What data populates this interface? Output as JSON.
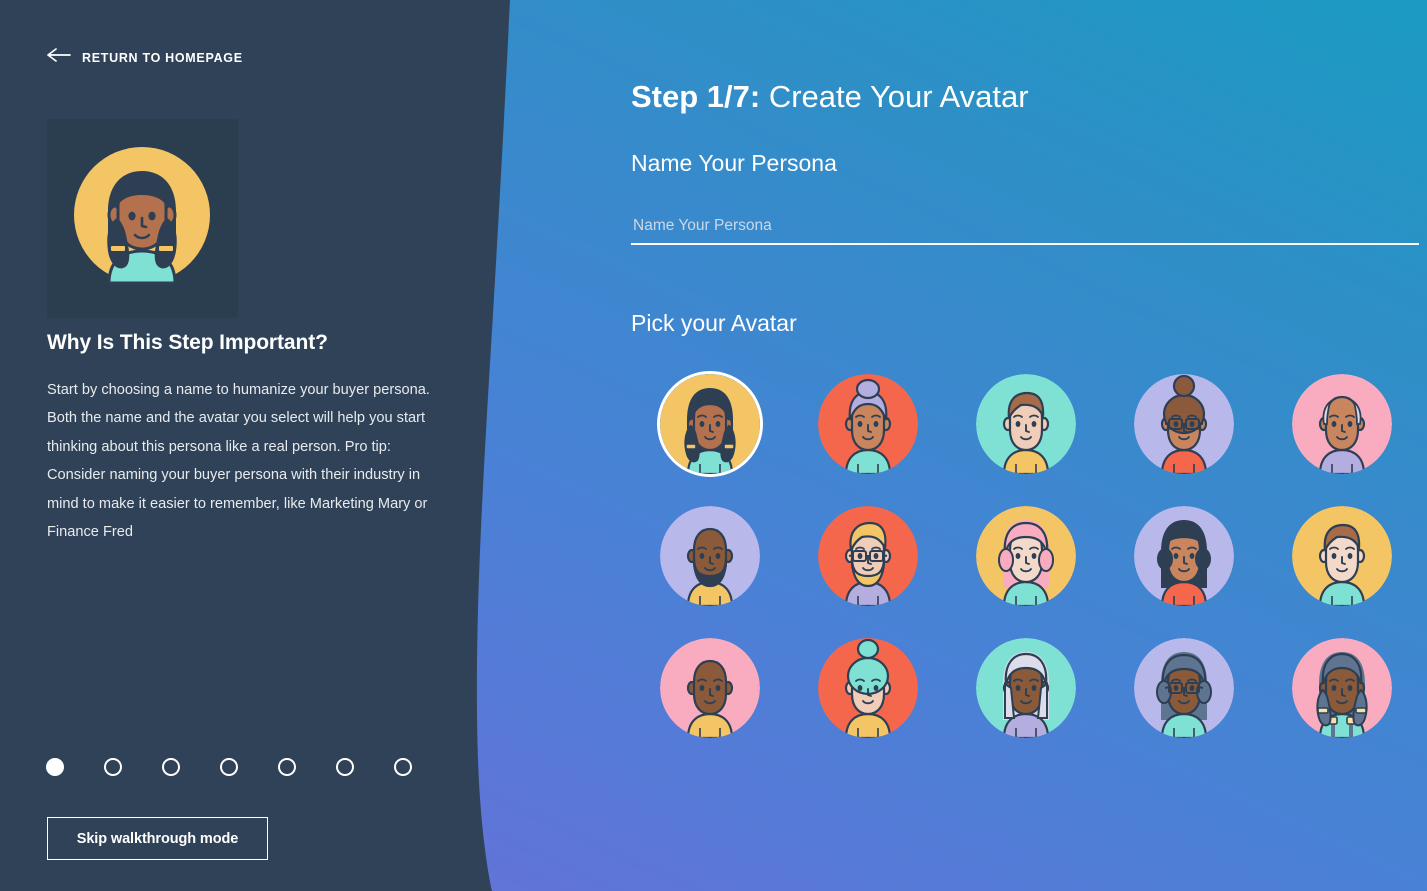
{
  "sidebar": {
    "return_link": {
      "label": "RETURN TO HOMEPAGE",
      "icon": "arrow-left-icon"
    },
    "preview": {
      "alt": "selected-avatar-preview",
      "bg_color": "#2b3e50",
      "circle_color": "#f4c565"
    },
    "heading": "Why Is This Step Important?",
    "body": "Start by choosing a name to humanize your buyer persona. Both the name and the avatar you select will help you start thinking about this persona like a real person. Pro tip: Consider naming your buyer persona with their industry in mind to make it easier to remember, like Marketing Mary or Finance Fred",
    "progress": {
      "total": 7,
      "current": 1
    },
    "skip_button_label": "Skip walkthrough mode",
    "bg_color": "#2f4257"
  },
  "main": {
    "step_prefix": "Step 1/7:",
    "step_title": "Create Your Avatar",
    "name_field": {
      "label": "Name Your Persona",
      "placeholder": "Name Your Persona",
      "value": ""
    },
    "pick_label": "Pick your Avatar",
    "selected_index": 0,
    "avatars": [
      {
        "name": "avatar-braids-tan-yellow",
        "bg": "#f4c565",
        "skin": "#b4714d",
        "hair": "#2e3f54",
        "shirt": "#7fe0d4",
        "accent": "#f4c565",
        "style": "braids",
        "glasses": false,
        "beard": false
      },
      {
        "name": "avatar-bun-lavender-orange",
        "bg": "#f4674d",
        "skin": "#c9865e",
        "hair": "#b4aee0",
        "shirt": "#7fe0d4",
        "accent": "#b4aee0",
        "style": "bun",
        "glasses": false,
        "beard": false
      },
      {
        "name": "avatar-swoop-brown-mint",
        "bg": "#7fe0d4",
        "skin": "#f0cdb8",
        "hair": "#a86b4a",
        "shirt": "#f4c565",
        "accent": "#a86b4a",
        "style": "swoop",
        "glasses": false,
        "beard": false
      },
      {
        "name": "avatar-afro-bun-glasses-periwinkle",
        "bg": "#b9b8ea",
        "skin": "#c9865e",
        "hair": "#8b5a3c",
        "shirt": "#f4674d",
        "accent": "#8b5a3c",
        "style": "afro-bun",
        "glasses": true,
        "beard": false
      },
      {
        "name": "avatar-bald-grey-pink",
        "bg": "#f9acc0",
        "skin": "#c9865e",
        "hair": "#dcdcea",
        "shirt": "#b4aee0",
        "accent": "#dcdcea",
        "style": "bald-sides",
        "glasses": false,
        "beard": false
      },
      {
        "name": "avatar-bald-beard-periwinkle",
        "bg": "#b9b8ea",
        "skin": "#8a5a3a",
        "hair": "#2e3f54",
        "shirt": "#f4c565",
        "accent": "#2e3f54",
        "style": "bald",
        "glasses": false,
        "beard": true
      },
      {
        "name": "avatar-blond-beard-glasses-orange",
        "bg": "#f4674d",
        "skin": "#f0cdb8",
        "hair": "#f4c565",
        "shirt": "#b4aee0",
        "accent": "#f4c565",
        "style": "blond-swoop",
        "glasses": true,
        "beard": true
      },
      {
        "name": "avatar-pink-bob-yellow",
        "bg": "#f4c565",
        "skin": "#f3d9ca",
        "hair": "#f9acc0",
        "shirt": "#7fe0d4",
        "accent": "#f9acc0",
        "style": "bob",
        "glasses": false,
        "beard": false
      },
      {
        "name": "avatar-dark-curls-periwinkle",
        "bg": "#b9b8ea",
        "skin": "#c9865e",
        "hair": "#2e3f54",
        "shirt": "#f4674d",
        "accent": "#2e3f54",
        "style": "curls",
        "glasses": false,
        "beard": false
      },
      {
        "name": "avatar-brown-swoop-yellow",
        "bg": "#f4c565",
        "skin": "#f3d9ca",
        "hair": "#a86b4a",
        "shirt": "#7fe0d4",
        "accent": "#a86b4a",
        "style": "swoop",
        "glasses": false,
        "beard": false
      },
      {
        "name": "avatar-bald-dark-pink",
        "bg": "#f9acc0",
        "skin": "#8a5a3a",
        "hair": "#8a5a3a",
        "shirt": "#f4c565",
        "accent": "#8a5a3a",
        "style": "bald",
        "glasses": false,
        "beard": false
      },
      {
        "name": "avatar-mint-curly-bun-orange",
        "bg": "#f4674d",
        "skin": "#f0cdb8",
        "hair": "#7fe0d4",
        "shirt": "#f4c565",
        "accent": "#7fe0d4",
        "style": "curly-bun",
        "glasses": false,
        "beard": false
      },
      {
        "name": "avatar-white-long-hair-mint",
        "bg": "#7fe0d4",
        "skin": "#8a5a3a",
        "hair": "#dcdcea",
        "shirt": "#b4aee0",
        "accent": "#dcdcea",
        "style": "long",
        "glasses": false,
        "beard": false
      },
      {
        "name": "avatar-grey-bob-glasses-periwinkle",
        "bg": "#b9b8ea",
        "skin": "#8a5a3a",
        "hair": "#5e7490",
        "shirt": "#7fe0d4",
        "accent": "#5e7490",
        "style": "bob",
        "glasses": true,
        "beard": false
      },
      {
        "name": "avatar-blue-braids-overalls-pink",
        "bg": "#f9acc0",
        "skin": "#8a5a3a",
        "hair": "#5e7490",
        "shirt": "#7fe0d4",
        "accent": "#f4e0a8",
        "style": "braids",
        "glasses": false,
        "beard": false
      }
    ]
  },
  "theme": {
    "gradient_start": "#1b9bc4",
    "gradient_end": "#6d6fd9",
    "sidebar": "#2f4257",
    "white": "#ffffff"
  }
}
